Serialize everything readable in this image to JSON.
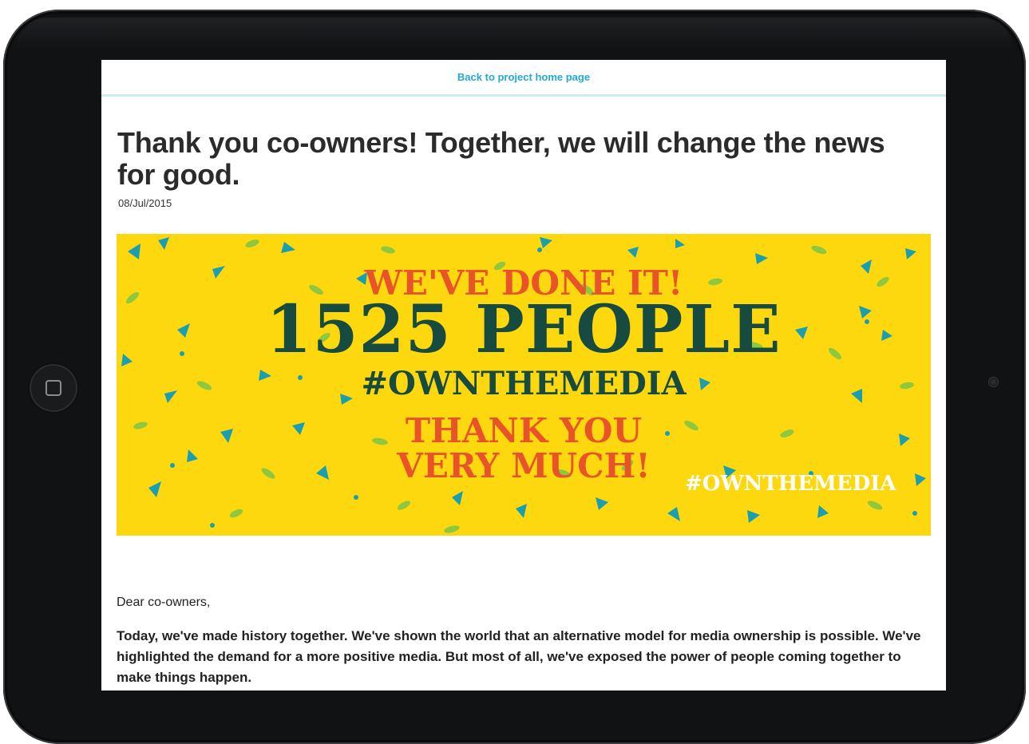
{
  "nav": {
    "back_link": "Back to project home page"
  },
  "post": {
    "title": "Thank you co-owners! Together, we will change the news for good.",
    "date": "08/Jul/2015"
  },
  "banner": {
    "line1": "WE'VE DONE IT!",
    "line2": "1525 PEOPLE",
    "line3": "#OWNTHEMEDIA",
    "line4": "THANK YOU",
    "line5": "VERY MUCH!",
    "tag": "#OWNTHEMEDIA",
    "colors": {
      "background": "#fed80e",
      "orange": "#e9532a",
      "green": "#174b3f",
      "teal": "#1a9fb0",
      "leaf": "#8fc73e"
    }
  },
  "content": {
    "greeting": "Dear co-owners,",
    "paragraph": "Today, we've made history together. We've shown the world that an alternative model for media ownership is possible. We've highlighted the demand for a more positive media. But most of all, we've exposed the power of people coming together to make things happen."
  },
  "device": {
    "home_button_icon": "square-icon",
    "camera_icon": "camera-icon"
  }
}
